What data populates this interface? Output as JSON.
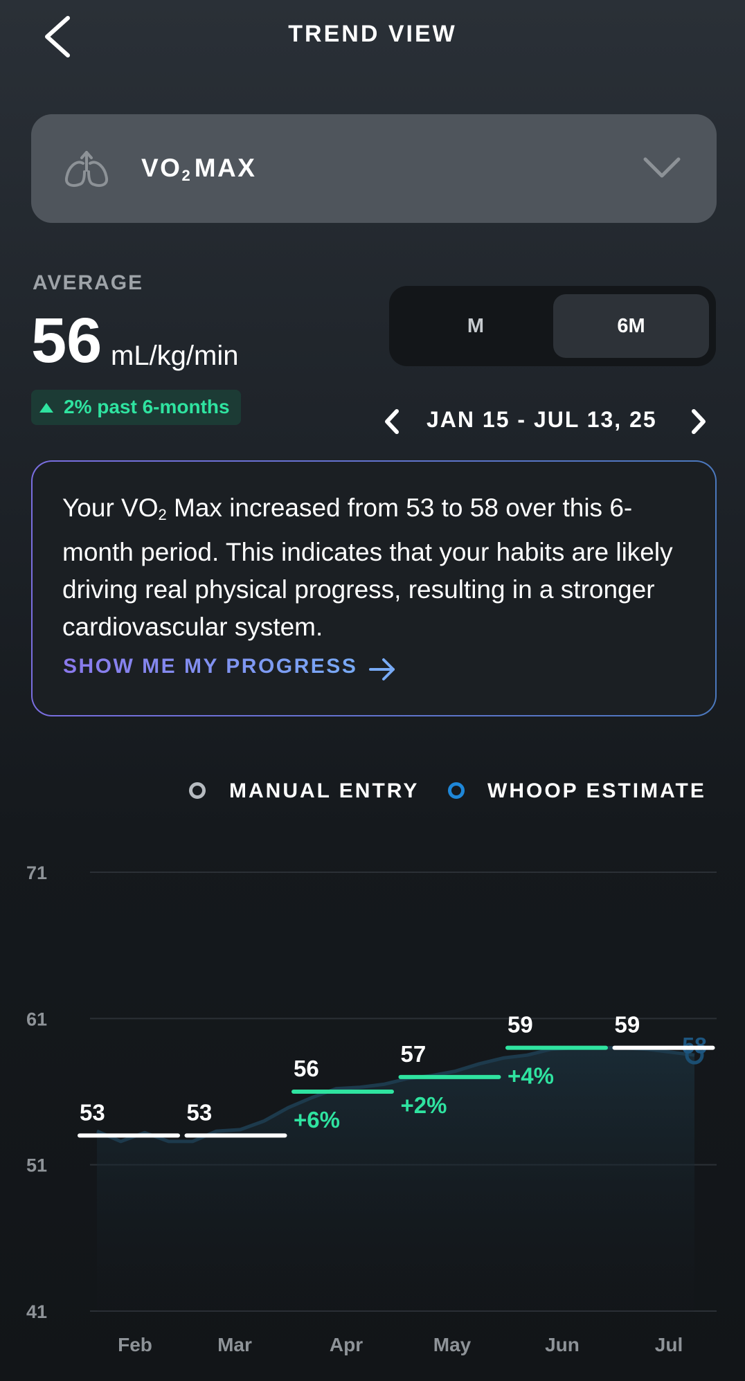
{
  "header": {
    "title": "TREND VIEW"
  },
  "metric": {
    "name_prefix": "VO",
    "name_sub": "2",
    "name_suffix": "MAX"
  },
  "average": {
    "label": "AVERAGE",
    "value": "56",
    "unit": "mL/kg/min",
    "change": "2% past 6-months"
  },
  "period": {
    "options": [
      "M",
      "6M"
    ],
    "selected": "6M"
  },
  "date_range": "JAN 15 - JUL 13, 25",
  "insight": {
    "part1": "Your VO",
    "sub": "2",
    "part2": " Max increased from 53 to 58 over this 6-month period. This indicates that your habits are likely driving real physical progress, resulting in a stronger cardiovascular system.",
    "cta": "SHOW ME MY PROGRESS"
  },
  "legend": {
    "manual": "MANUAL ENTRY",
    "whoop": "WHOOP ESTIMATE"
  },
  "colors": {
    "accent_green": "#2fe3a0",
    "whoop_blue": "#1f87d8",
    "manual_gray": "#b6bbc0"
  },
  "chart_data": {
    "type": "line",
    "ylim": [
      41,
      71
    ],
    "yticks": [
      71,
      61,
      51,
      41
    ],
    "xticks": [
      "Feb",
      "Mar",
      "Apr",
      "May",
      "Jun",
      "Jul"
    ],
    "monthly_averages": [
      {
        "value": 53,
        "change": "",
        "trend": "flat"
      },
      {
        "value": 53,
        "change": "",
        "trend": "flat"
      },
      {
        "value": 56,
        "change": "+6%",
        "trend": "up"
      },
      {
        "value": 57,
        "change": "+2%",
        "trend": "up"
      },
      {
        "value": 59,
        "change": "+4%",
        "trend": "up"
      },
      {
        "value": 59,
        "change": "",
        "trend": "flat"
      }
    ],
    "series": [
      {
        "name": "WHOOP ESTIMATE",
        "values": [
          53.3,
          52.6,
          53.2,
          52.6,
          52.6,
          53.3,
          53.4,
          54,
          54.9,
          55.6,
          56.2,
          56.3,
          56.5,
          56.9,
          57.1,
          57.4,
          57.9,
          58.3,
          58.5,
          58.9,
          59,
          59,
          59,
          58.9,
          58.7,
          58.5
        ]
      }
    ],
    "latest_estimate": 58
  }
}
